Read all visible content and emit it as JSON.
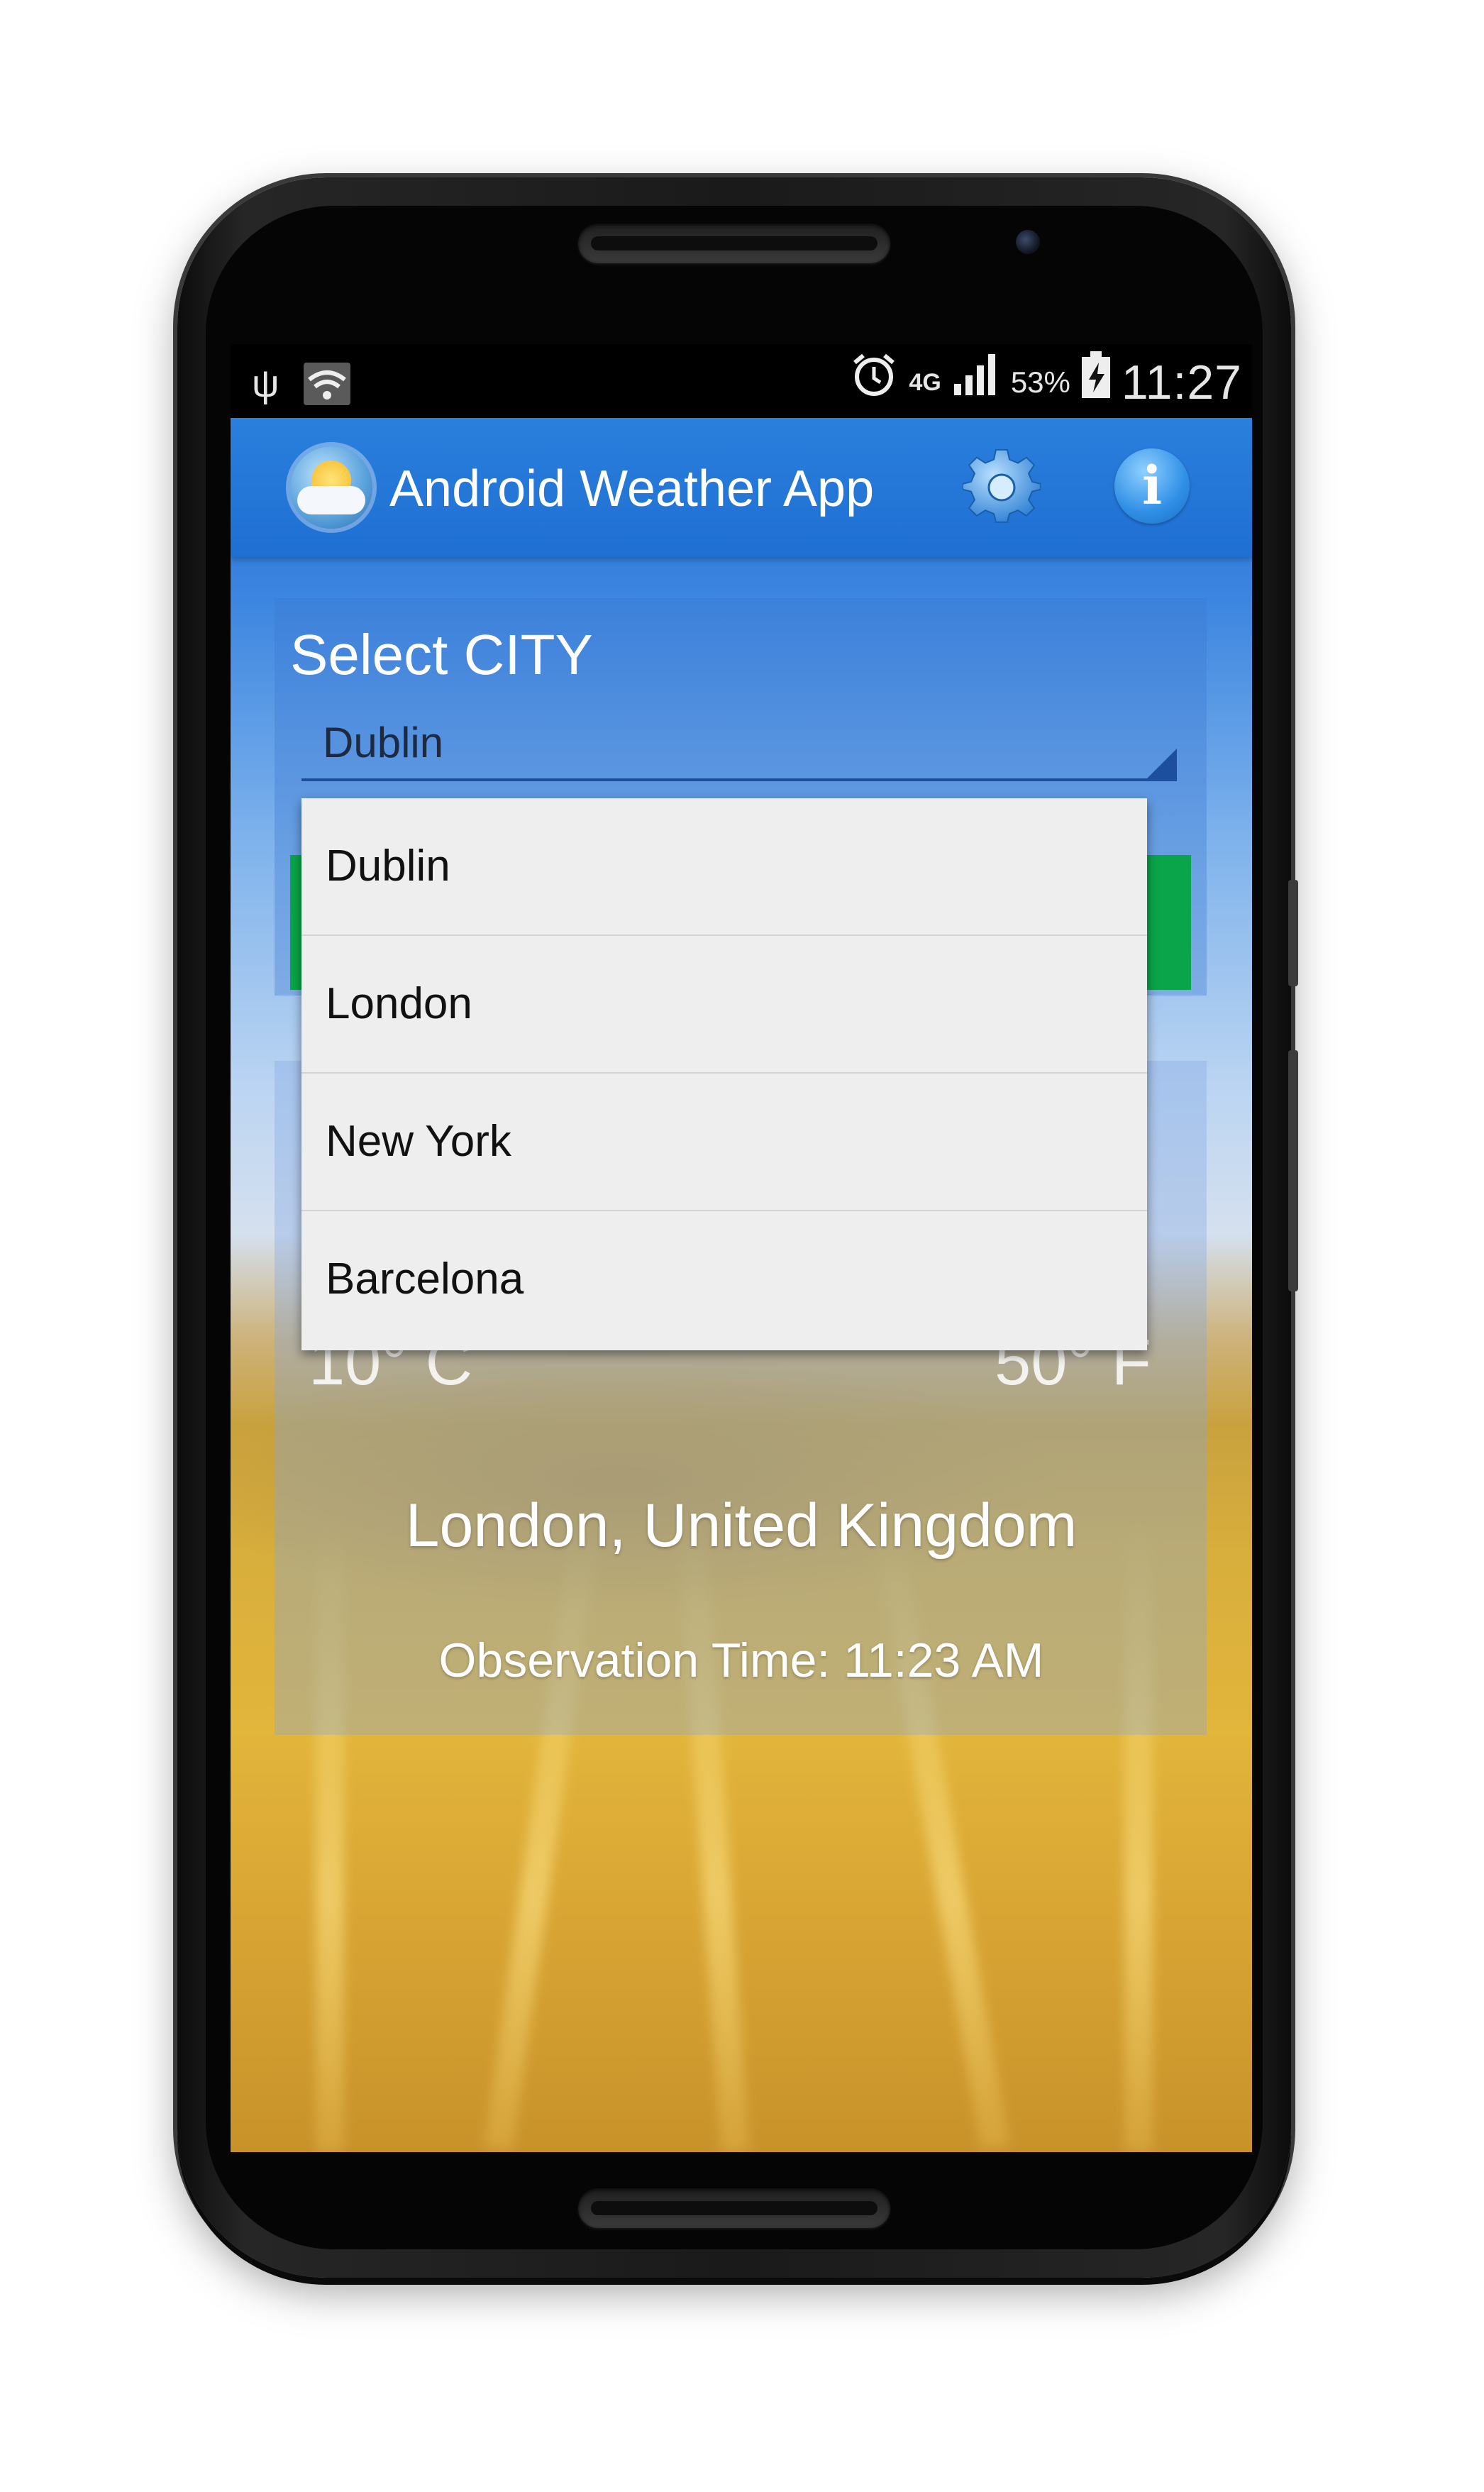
{
  "statusbar": {
    "icons_left": [
      "usb-icon",
      "wifi-icon"
    ],
    "icons_right": [
      "alarm-icon",
      "network-4g-icon",
      "signal-icon",
      "battery-charging-icon"
    ],
    "network_type": "4G",
    "battery_percent": "53%",
    "time": "11:27"
  },
  "actionbar": {
    "title": "Android Weather App",
    "logo": "weather-app-logo",
    "settings_icon": "gear-icon",
    "info_icon": "info-icon",
    "info_glyph": "i"
  },
  "city_select": {
    "label": "Select CITY",
    "selected": "Dublin"
  },
  "dropdown": {
    "options": [
      {
        "label": "Dublin"
      },
      {
        "label": "London"
      },
      {
        "label": "New York"
      },
      {
        "label": "Barcelona"
      }
    ]
  },
  "weather": {
    "temp_c": "10° C",
    "temp_f": "50° F",
    "location": "London, United Kingdom",
    "observation_time": "Observation Time: 11:23 AM"
  },
  "colors": {
    "action_bar": "#2a7fdc",
    "green_button": "#0aa54a",
    "dropdown_bg": "#eeeeee"
  }
}
